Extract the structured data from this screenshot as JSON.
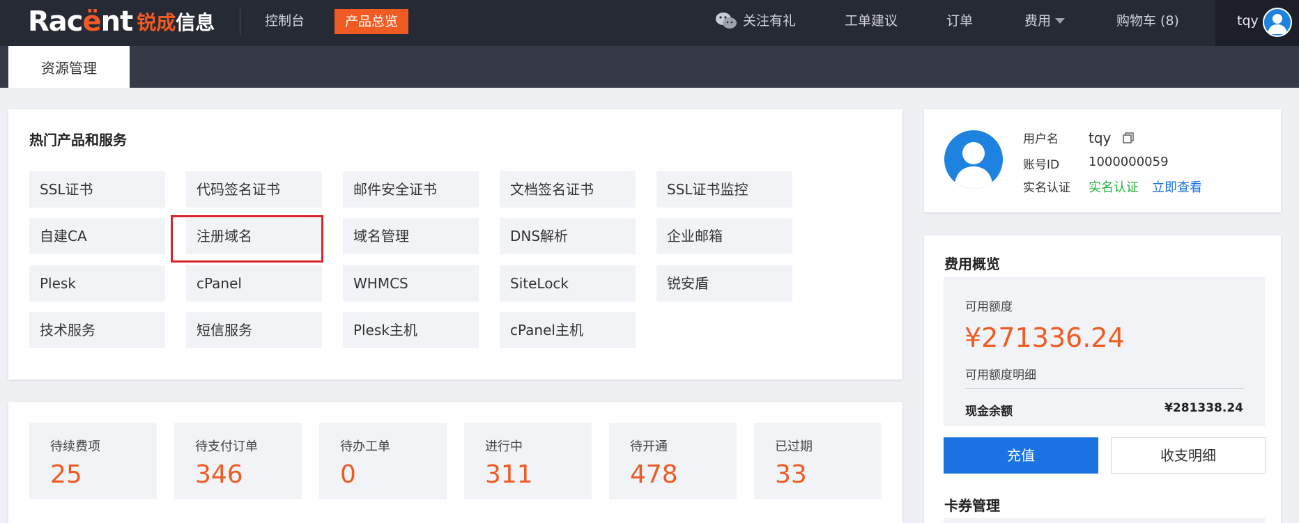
{
  "header": {
    "logo_text_a": "Rac",
    "logo_text_e": "ë",
    "logo_text_b": "nt",
    "logo_cn_a": "锐成",
    "logo_cn_b": "信息",
    "nav_console": "控制台",
    "nav_products": "产品总览",
    "nav_follow": "关注有礼",
    "nav_ticket": "工单建议",
    "nav_orders": "订单",
    "nav_fees": "费用",
    "nav_cart": "购物车 (8)",
    "user": "tqy"
  },
  "tabs": {
    "active": "资源管理"
  },
  "hot": {
    "title": "热门产品和服务",
    "items": [
      [
        "SSL证书",
        "代码签名证书",
        "邮件安全证书",
        "文档签名证书",
        "SSL证书监控"
      ],
      [
        "自建CA",
        "注册域名",
        "域名管理",
        "DNS解析",
        "企业邮箱"
      ],
      [
        "Plesk",
        "cPanel",
        "WHMCS",
        "SiteLock",
        "锐安盾"
      ],
      [
        "技术服务",
        "短信服务",
        "Plesk主机",
        "cPanel主机"
      ]
    ]
  },
  "stats": [
    {
      "label": "待续费项",
      "value": "25"
    },
    {
      "label": "待支付订单",
      "value": "346"
    },
    {
      "label": "待办工单",
      "value": "0"
    },
    {
      "label": "进行中",
      "value": "311"
    },
    {
      "label": "待开通",
      "value": "478"
    },
    {
      "label": "已过期",
      "value": "33"
    }
  ],
  "account": {
    "username_label": "用户名",
    "username": "tqy",
    "id_label": "账号ID",
    "id": "1000000059",
    "realname_label": "实名认证",
    "realname_status": "实名认证",
    "realname_link": "立即查看"
  },
  "fee": {
    "title": "费用概览",
    "available_label": "可用额度",
    "available_value": "¥271336.24",
    "available_detail": "可用额度明细",
    "cash_label": "现金余额",
    "cash_value": "¥281338.24",
    "recharge": "充值",
    "detail": "收支明细"
  },
  "card": {
    "title": "卡券管理"
  },
  "colors": {
    "accent": "#ef5b22",
    "primary": "#1a73e0",
    "green": "#1fb33c",
    "nav_bg": "#262a35"
  }
}
